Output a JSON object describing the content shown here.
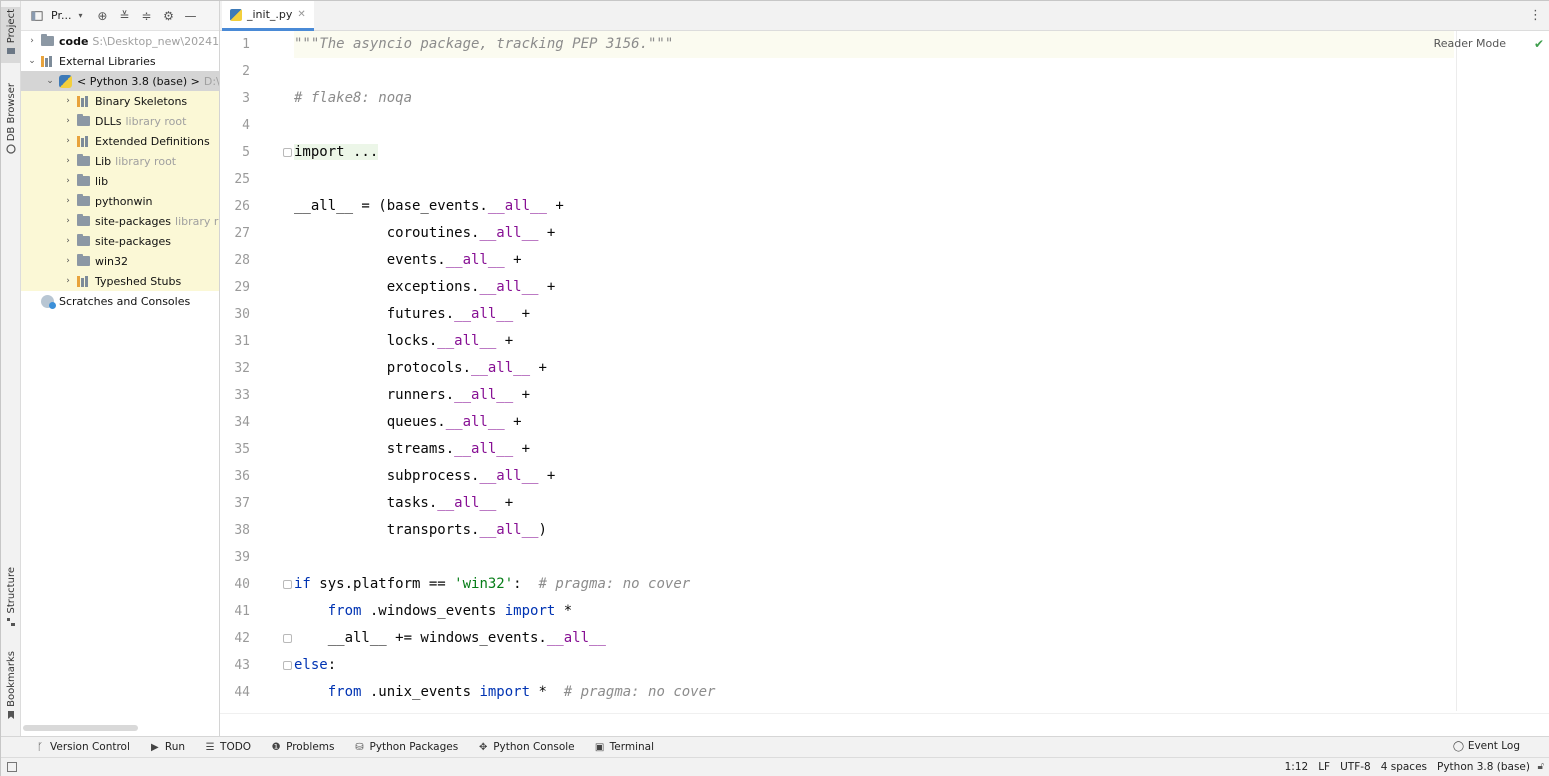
{
  "project_panel": {
    "title": "Pr...",
    "tree": [
      {
        "label": "code",
        "hint": "S:\\Desktop_new\\20241",
        "bold": true,
        "indent": 0,
        "icon": "folder-icon",
        "chevron": "›"
      },
      {
        "label": "External Libraries",
        "hint": "",
        "indent": 0,
        "icon": "library-icon",
        "chevron": "⌄"
      },
      {
        "label": "< Python 3.8 (base) >",
        "hint": "D:\\",
        "indent": 1,
        "icon": "python-icon",
        "chevron": "⌄"
      },
      {
        "label": "Binary Skeletons",
        "hint": "",
        "indent": 2,
        "icon": "library-icon",
        "chevron": "›"
      },
      {
        "label": "DLLs",
        "hint": "library root",
        "indent": 2,
        "icon": "folder-icon",
        "chevron": "›"
      },
      {
        "label": "Extended Definitions",
        "hint": "",
        "indent": 2,
        "icon": "library-icon",
        "chevron": "›"
      },
      {
        "label": "Lib",
        "hint": "library root",
        "indent": 2,
        "icon": "folder-icon",
        "chevron": "›"
      },
      {
        "label": "lib",
        "hint": "",
        "indent": 2,
        "icon": "folder-icon",
        "chevron": "›"
      },
      {
        "label": "pythonwin",
        "hint": "",
        "indent": 2,
        "icon": "folder-icon",
        "chevron": "›"
      },
      {
        "label": "site-packages",
        "hint": "library r",
        "indent": 2,
        "icon": "folder-icon",
        "chevron": "›"
      },
      {
        "label": "site-packages",
        "hint": "",
        "indent": 2,
        "icon": "folder-icon",
        "chevron": "›"
      },
      {
        "label": "win32",
        "hint": "",
        "indent": 2,
        "icon": "folder-icon",
        "chevron": "›"
      },
      {
        "label": "Typeshed Stubs",
        "hint": "",
        "indent": 2,
        "icon": "library-icon",
        "chevron": "›"
      },
      {
        "label": "Scratches and Consoles",
        "hint": "",
        "indent": 0,
        "icon": "scratches-icon",
        "chevron": ""
      }
    ]
  },
  "left_strip": {
    "project": "Project",
    "db_browser": "DB Browser",
    "structure": "Structure",
    "bookmarks": "Bookmarks"
  },
  "editor": {
    "tab_label": "_init_.py",
    "reader_mode": "Reader Mode",
    "lines": [
      {
        "n": "1",
        "parts": [
          {
            "t": "\"\"\"The asyncio package, tracking PEP 3156.\"\"\"",
            "c": "doc"
          }
        ]
      },
      {
        "n": "2",
        "parts": []
      },
      {
        "n": "3",
        "parts": [
          {
            "t": "# flake8: noqa",
            "c": "comment"
          }
        ]
      },
      {
        "n": "4",
        "parts": []
      },
      {
        "n": "5",
        "parts": [
          {
            "t": "import ...",
            "c": "import-hl"
          }
        ]
      },
      {
        "n": "25",
        "parts": []
      },
      {
        "n": "26",
        "parts": [
          {
            "t": "__all__ = (base_events.",
            "c": ""
          },
          {
            "t": "__all__",
            "c": "dunder"
          },
          {
            "t": " +",
            "c": ""
          }
        ]
      },
      {
        "n": "27",
        "parts": [
          {
            "t": "           coroutines.",
            "c": ""
          },
          {
            "t": "__all__",
            "c": "dunder"
          },
          {
            "t": " +",
            "c": ""
          }
        ]
      },
      {
        "n": "28",
        "parts": [
          {
            "t": "           events.",
            "c": ""
          },
          {
            "t": "__all__",
            "c": "dunder"
          },
          {
            "t": " +",
            "c": ""
          }
        ]
      },
      {
        "n": "29",
        "parts": [
          {
            "t": "           exceptions.",
            "c": ""
          },
          {
            "t": "__all__",
            "c": "dunder"
          },
          {
            "t": " +",
            "c": ""
          }
        ]
      },
      {
        "n": "30",
        "parts": [
          {
            "t": "           futures.",
            "c": ""
          },
          {
            "t": "__all__",
            "c": "dunder"
          },
          {
            "t": " +",
            "c": ""
          }
        ]
      },
      {
        "n": "31",
        "parts": [
          {
            "t": "           locks.",
            "c": ""
          },
          {
            "t": "__all__",
            "c": "dunder"
          },
          {
            "t": " +",
            "c": ""
          }
        ]
      },
      {
        "n": "32",
        "parts": [
          {
            "t": "           protocols.",
            "c": ""
          },
          {
            "t": "__all__",
            "c": "dunder"
          },
          {
            "t": " +",
            "c": ""
          }
        ]
      },
      {
        "n": "33",
        "parts": [
          {
            "t": "           runners.",
            "c": ""
          },
          {
            "t": "__all__",
            "c": "dunder"
          },
          {
            "t": " +",
            "c": ""
          }
        ]
      },
      {
        "n": "34",
        "parts": [
          {
            "t": "           queues.",
            "c": ""
          },
          {
            "t": "__all__",
            "c": "dunder"
          },
          {
            "t": " +",
            "c": ""
          }
        ]
      },
      {
        "n": "35",
        "parts": [
          {
            "t": "           streams.",
            "c": ""
          },
          {
            "t": "__all__",
            "c": "dunder"
          },
          {
            "t": " +",
            "c": ""
          }
        ]
      },
      {
        "n": "36",
        "parts": [
          {
            "t": "           subprocess.",
            "c": ""
          },
          {
            "t": "__all__",
            "c": "dunder"
          },
          {
            "t": " +",
            "c": ""
          }
        ]
      },
      {
        "n": "37",
        "parts": [
          {
            "t": "           tasks.",
            "c": ""
          },
          {
            "t": "__all__",
            "c": "dunder"
          },
          {
            "t": " +",
            "c": ""
          }
        ]
      },
      {
        "n": "38",
        "parts": [
          {
            "t": "           transports.",
            "c": ""
          },
          {
            "t": "__all__",
            "c": "dunder"
          },
          {
            "t": ")",
            "c": ""
          }
        ]
      },
      {
        "n": "39",
        "parts": []
      },
      {
        "n": "40",
        "parts": [
          {
            "t": "if",
            "c": "kw"
          },
          {
            "t": " sys.platform == ",
            "c": ""
          },
          {
            "t": "'win32'",
            "c": "str"
          },
          {
            "t": ":  ",
            "c": ""
          },
          {
            "t": "# pragma: no cover",
            "c": "comment"
          }
        ]
      },
      {
        "n": "41",
        "parts": [
          {
            "t": "    ",
            "c": ""
          },
          {
            "t": "from",
            "c": "kw"
          },
          {
            "t": " .windows_events ",
            "c": ""
          },
          {
            "t": "import",
            "c": "kw"
          },
          {
            "t": " *",
            "c": ""
          }
        ]
      },
      {
        "n": "42",
        "parts": [
          {
            "t": "    __all__ += windows_events.",
            "c": ""
          },
          {
            "t": "__all__",
            "c": "dunder"
          }
        ]
      },
      {
        "n": "43",
        "parts": [
          {
            "t": "else",
            "c": "kw"
          },
          {
            "t": ":",
            "c": ""
          }
        ]
      },
      {
        "n": "44",
        "parts": [
          {
            "t": "    ",
            "c": ""
          },
          {
            "t": "from",
            "c": "kw"
          },
          {
            "t": " .unix_events ",
            "c": ""
          },
          {
            "t": "import",
            "c": "kw"
          },
          {
            "t": " *  ",
            "c": ""
          },
          {
            "t": "# pragma: no cover",
            "c": "comment"
          }
        ]
      }
    ]
  },
  "bottom_tools": [
    {
      "label": "Version Control",
      "icon": "version-control-icon",
      "glyph": "ᚴ"
    },
    {
      "label": "Run",
      "icon": "run-icon",
      "glyph": "▶"
    },
    {
      "label": "TODO",
      "icon": "todo-icon",
      "glyph": "☰"
    },
    {
      "label": "Problems",
      "icon": "problems-icon",
      "glyph": "❶"
    },
    {
      "label": "Python Packages",
      "icon": "python-packages-icon",
      "glyph": "⛁"
    },
    {
      "label": "Python Console",
      "icon": "python-console-icon",
      "glyph": "✥"
    },
    {
      "label": "Terminal",
      "icon": "terminal-icon",
      "glyph": "▣"
    }
  ],
  "event_log": "Event Log",
  "status": {
    "position": "1:12",
    "line_sep": "LF",
    "encoding": "UTF-8",
    "indent": "4 spaces",
    "interpreter": "Python 3.8 (base)"
  }
}
